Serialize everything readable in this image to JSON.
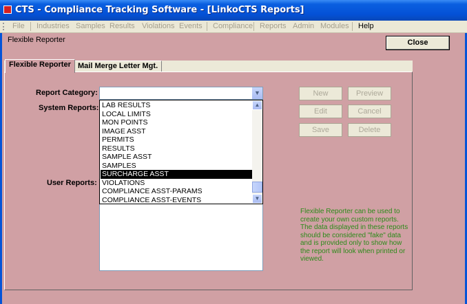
{
  "window": {
    "title": "CTS - Compliance Tracking Software - [LinkoCTS Reports]"
  },
  "menu": {
    "items": [
      "File",
      "Industries",
      "Samples",
      "Results",
      "Violations",
      "Events",
      "Compliance",
      "Reports",
      "Admin",
      "Modules",
      "Help"
    ]
  },
  "header": {
    "section_label": "Flexible Reporter",
    "close_label": "Close"
  },
  "tabs": [
    {
      "label": "Flexible Reporter",
      "active": true
    },
    {
      "label": "Mail Merge Letter Mgt.",
      "active": false
    }
  ],
  "form": {
    "report_category_label": "Report Category:",
    "report_category_value": "",
    "system_reports_label": "System Reports:",
    "user_reports_label": "User Reports:"
  },
  "dropdown": {
    "items": [
      "LAB RESULTS",
      "LOCAL LIMITS",
      "MON POINTS",
      "IMAGE ASST",
      "PERMITS",
      "RESULTS",
      "SAMPLE ASST",
      "SAMPLES",
      "SURCHARGE ASST",
      "VIOLATIONS",
      "COMPLIANCE ASST-PARAMS",
      "COMPLIANCE ASST-EVENTS"
    ],
    "selected": "SURCHARGE ASST"
  },
  "buttons": {
    "new": "New",
    "preview": "Preview",
    "edit": "Edit",
    "cancel": "Cancel",
    "save": "Save",
    "delete": "Delete"
  },
  "note": "Flexible Reporter can be used to create your own custom reports.  The data displayed in these reports should be considered \"fake\" data and is provided only to show how the report will look when printed or viewed.",
  "colors": {
    "background": "#d0a0a4",
    "note_text": "#2c8a1a",
    "titlebar": "#0451d6"
  }
}
